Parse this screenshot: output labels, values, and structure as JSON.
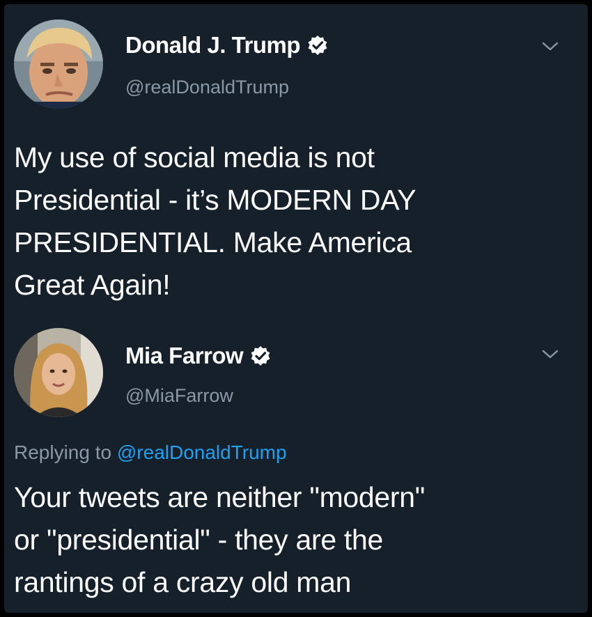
{
  "tweets": [
    {
      "author": {
        "name": "Donald J. Trump",
        "handle": "@realDonaldTrump",
        "verified": true
      },
      "text_lines": [
        "My use of social media is not",
        "Presidential - it’s MODERN DAY",
        "PRESIDENTIAL. Make America",
        "Great Again!"
      ]
    },
    {
      "author": {
        "name": "Mia Farrow",
        "handle": "@MiaFarrow",
        "verified": true
      },
      "reply": {
        "label": "Replying to",
        "handle": "@realDonaldTrump"
      },
      "text_lines": [
        "Your tweets are neither \"modern\"",
        "or \"presidential\" - they are the",
        "rantings of a crazy old man"
      ]
    }
  ],
  "colors": {
    "background": "#15202b",
    "primary_text": "#ffffff",
    "secondary_text": "#8b98a5",
    "link": "#1da1f2"
  },
  "icons": {
    "verified": "verified-badge-icon",
    "menu": "chevron-down-icon"
  }
}
